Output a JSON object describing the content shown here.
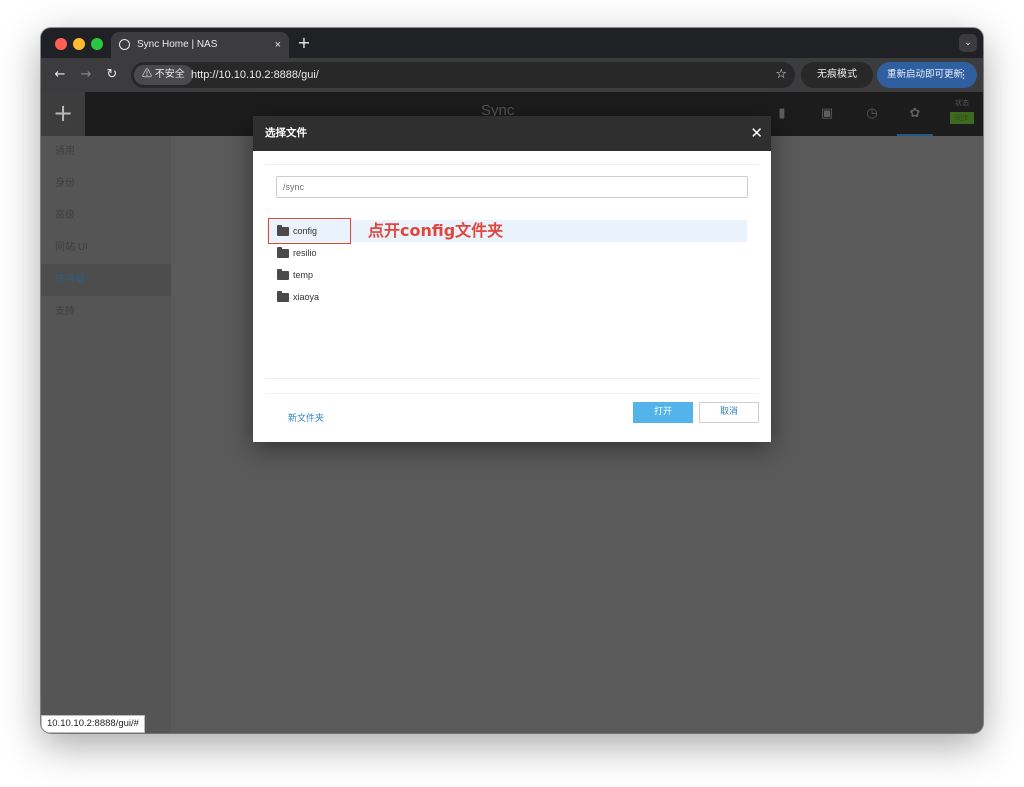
{
  "browser": {
    "tab_title": "Sync Home | NAS",
    "tab_close": "×",
    "new_tab": "+",
    "tab_menu": "⌄",
    "security_label": "⚠ 不安全",
    "url": "http://10.10.10.2:8888/gui/",
    "star": "☆",
    "incognito_label": "无痕模式",
    "incognito_icon": "🕶",
    "update_label": "重新启动即可更新",
    "update_menu": "⋮",
    "back": "←",
    "forward": "→",
    "reload": "↻",
    "status_url": "10.10.10.2:8888/gui/#",
    "traffic_lights": {
      "close": "#ff5f57",
      "minimize": "#febc2e",
      "maximize": "#28c840"
    }
  },
  "app": {
    "add_button": "+",
    "brand": "Sync",
    "header_icons": [
      "folder-icon",
      "list-icon",
      "clock-icon",
      "gear-icon"
    ],
    "status_label": "状态",
    "status_badge": "同步",
    "sidebar": [
      "通用",
      "身份",
      "高级",
      "网站 UI",
      "许可证",
      "支持"
    ],
    "sidebar_active_index": 4
  },
  "dialog": {
    "title": "选择文件",
    "close": "✕",
    "path_placeholder": "/sync",
    "folders": [
      "config",
      "resilio",
      "temp",
      "xiaoya"
    ],
    "selected_index": 0,
    "annotation": "点开config文件夹",
    "new_folder": "新文件夹",
    "open_button": "打开",
    "cancel_button": "取消"
  },
  "colors": {
    "accent": "#52b4ea",
    "link": "#2f83c5",
    "annotation_red": "#e0463d",
    "update_button": "#2f5f9f"
  }
}
